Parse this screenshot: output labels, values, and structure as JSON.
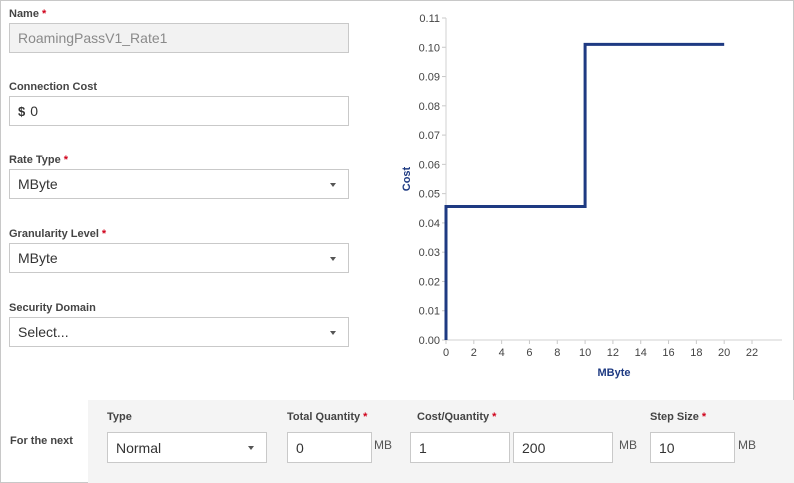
{
  "form": {
    "name": {
      "label": "Name",
      "required_mark": "*",
      "value": "RoamingPassV1_Rate1"
    },
    "connection_cost": {
      "label": "Connection Cost",
      "currency": "$",
      "value": "0"
    },
    "rate_type": {
      "label": "Rate Type",
      "required_mark": "*",
      "value": "MByte"
    },
    "granularity_level": {
      "label": "Granularity Level",
      "required_mark": "*",
      "value": "MByte"
    },
    "security_domain": {
      "label": "Security Domain",
      "value": "Select..."
    }
  },
  "step_row": {
    "row_label": "For the next",
    "type": {
      "label": "Type",
      "value": "Normal"
    },
    "total_quantity": {
      "label": "Total Quantity",
      "required_mark": "*",
      "value": "0",
      "unit": "MB"
    },
    "cost_quantity": {
      "label": "Cost/Quantity",
      "required_mark": "*",
      "cost": "1",
      "quantity": "200",
      "unit": "MB"
    },
    "step_size": {
      "label": "Step Size",
      "required_mark": "*",
      "value": "10",
      "unit": "MB"
    }
  },
  "chart_data": {
    "type": "line",
    "step": true,
    "xlabel": "MByte",
    "ylabel": "Cost",
    "xlim": [
      0,
      22
    ],
    "ylim": [
      0,
      0.11
    ],
    "x_ticks": [
      "0",
      "2",
      "4",
      "6",
      "8",
      "10",
      "12",
      "14",
      "16",
      "18",
      "20",
      "22"
    ],
    "y_ticks": [
      "0.00",
      "0.01",
      "0.02",
      "0.03",
      "0.04",
      "0.05",
      "0.06",
      "0.07",
      "0.08",
      "0.09",
      "0.10",
      "0.11"
    ],
    "grid": false,
    "line_color": "#1e3a82",
    "points": [
      {
        "x": 0,
        "y": 0
      },
      {
        "x": 0,
        "y": 0.0456
      },
      {
        "x": 10,
        "y": 0.0456
      },
      {
        "x": 10,
        "y": 0.101
      },
      {
        "x": 20,
        "y": 0.101
      }
    ]
  }
}
